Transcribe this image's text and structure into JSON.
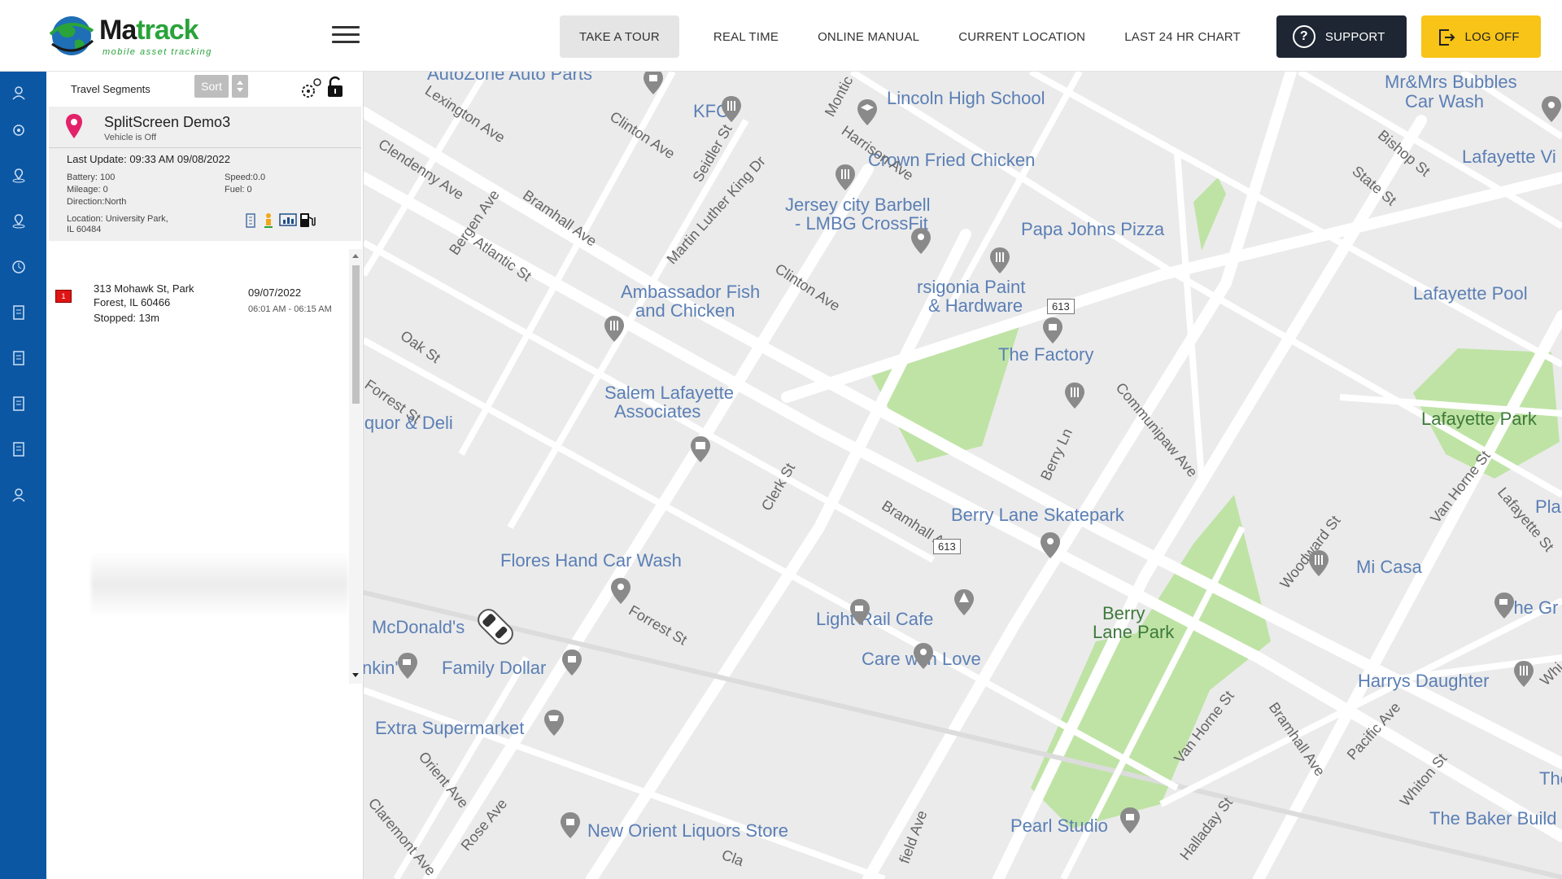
{
  "brand": {
    "name_part1": "Ma",
    "name_part2": "track",
    "tagline": "mobile asset tracking"
  },
  "nav": {
    "items": [
      "TAKE A TOUR",
      "REAL TIME",
      "ONLINE MANUAL",
      "CURRENT LOCATION",
      "LAST 24 HR CHART"
    ],
    "support_label": "SUPPORT",
    "logoff_label": "LOG OFF"
  },
  "colors": {
    "rail": "#0c57a4",
    "support_bg": "#1e2633",
    "logoff_bg": "#f7c417",
    "stop_badge": "#e01414"
  },
  "panel": {
    "title": "Travel Segments",
    "sort_label": "Sort",
    "vehicle": {
      "name": "SplitScreen Demo3",
      "status": "Vehicle is Off",
      "last_update": "Last Update: 09:33 AM 09/08/2022",
      "battery": "Battery: 100",
      "speed": "Speed:0.0",
      "mileage": "Mileage: 0",
      "fuel": "Fuel: 0",
      "direction": "Direction:North",
      "location_line1": "Location: University Park,",
      "location_line2": "IL 60484"
    },
    "segments": [
      {
        "badge": "1",
        "address_line1": "313 Mohawk St, Park",
        "address_line2": "Forest, IL 60466",
        "stopped": "Stopped: 13m",
        "date": "09/07/2022",
        "time": "06:01 AM - 06:15 AM"
      }
    ]
  },
  "map": {
    "pois": [
      "AutoZone Auto Parts",
      "KFC",
      "Lincoln High School",
      "Mr&Mrs Bubbles",
      "Car Wash",
      "Crown Fried Chicken",
      "Lafayette Vi",
      "Jersey city Barbell",
      "- LMBG CrossFit",
      "Papa Johns Pizza",
      "Ambassador Fish",
      "and Chicken",
      "rsigonia Paint",
      "& Hardware",
      "Lafayette Pool",
      "The Factory",
      "Salem Lafayette",
      "Associates",
      "iquor & Deli",
      "Lafayette Park",
      "Berry Lane Skatepark",
      "Flores Hand Car Wash",
      "Mi Casa",
      "McDonald's",
      "Light Rail Cafe",
      "Care with Love",
      "The Gr",
      "Family Dollar",
      "nkin'",
      "Harrys Daughter",
      "Extra Supermarket",
      "New Orient Liquors Store",
      "Pearl Studio",
      "The Baker Build",
      "The",
      "Plan"
    ],
    "parks": [
      "Berry",
      "Lane Park"
    ],
    "streets": [
      "Lexington Ave",
      "Clinton Ave",
      "Seidler St",
      "Harrison Ave",
      "Montic",
      "Clendenny Ave",
      "Bergen Ave",
      "Bramhall Ave",
      "Martin Luther King Dr",
      "Atlantic St",
      "Bishop St",
      "State St",
      "Clinton Ave",
      "Oak St",
      "Forrest St",
      "Clerk St",
      "Bramhall Ave",
      "Berry Ln",
      "Communipaw Ave",
      "Van Horne St",
      "Lafayette St",
      "Woodward St",
      "Forrest St",
      "Orient Ave",
      "Claremont Ave",
      "Rose Ave",
      "Van Horne St",
      "Bramhall Ave",
      "Pacific Ave",
      "Whiton St",
      "Halladay St",
      "field Ave",
      "Cla",
      "Whi"
    ],
    "route_numbers": [
      "613",
      "613"
    ]
  }
}
